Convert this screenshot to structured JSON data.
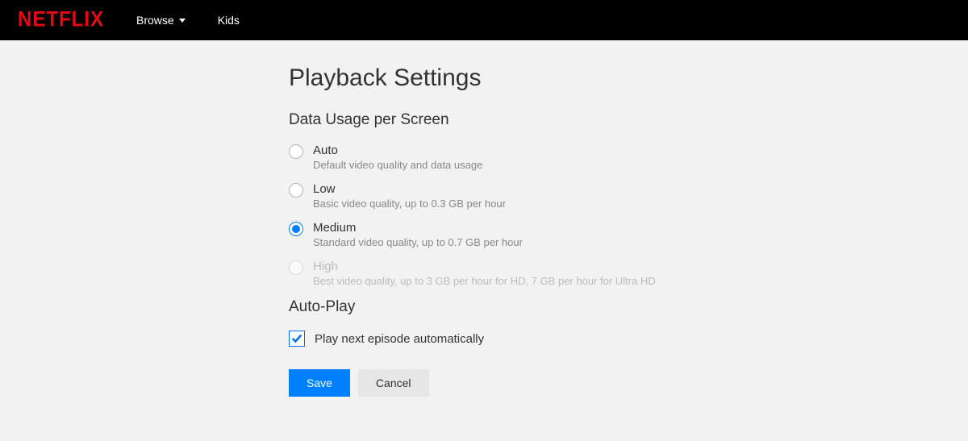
{
  "header": {
    "logo_text": "NETFLIX",
    "nav": {
      "browse": "Browse",
      "kids": "Kids"
    }
  },
  "page": {
    "title": "Playback Settings",
    "data_usage": {
      "heading": "Data Usage per Screen",
      "selected": "medium",
      "options": {
        "auto": {
          "label": "Auto",
          "description": "Default video quality and data usage",
          "disabled": false
        },
        "low": {
          "label": "Low",
          "description": "Basic video quality, up to 0.3 GB per hour",
          "disabled": false
        },
        "medium": {
          "label": "Medium",
          "description": "Standard video quality, up to 0.7 GB per hour",
          "disabled": false
        },
        "high": {
          "label": "High",
          "description": "Best video quality, up to 3 GB per hour for HD, 7 GB per hour for Ultra HD",
          "disabled": true
        }
      }
    },
    "autoplay": {
      "heading": "Auto-Play",
      "checkbox_label": "Play next episode automatically",
      "checked": true
    },
    "buttons": {
      "save": "Save",
      "cancel": "Cancel"
    }
  }
}
